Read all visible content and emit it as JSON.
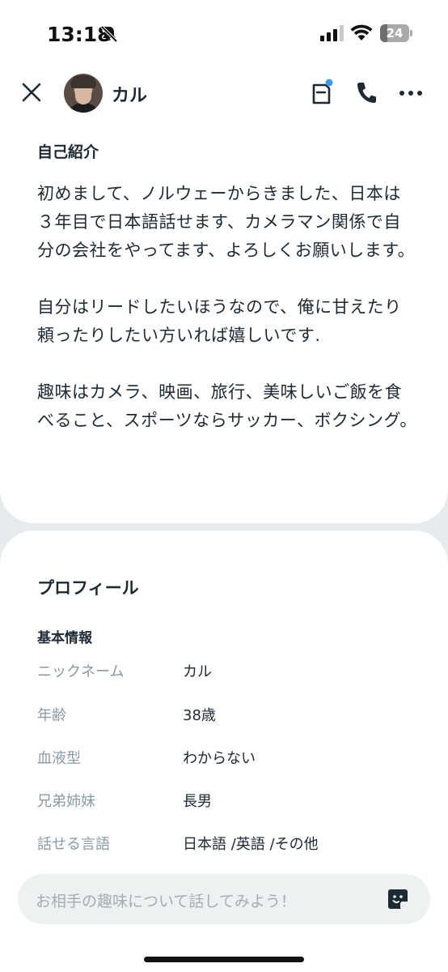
{
  "status_bar": {
    "time": "13:18",
    "battery_level": "24"
  },
  "header": {
    "username": "カル"
  },
  "intro": {
    "title": "自己紹介",
    "paragraphs": [
      "初めまして、ノルウェーからきました、日本は３年目で日本語話せます、カメラマン関係で自分の会社をやってます、よろしくお願いします。",
      "自分はリードしたいほうなので、俺に甘えたり頼ったりしたい方いれば嬉しいです.",
      "趣味はカメラ、映画、旅行、美味しいご飯を食べること、スポーツならサッカー、ボクシング。"
    ]
  },
  "profile": {
    "title": "プロフィール",
    "basic_info_title": "基本情報",
    "rows": [
      {
        "label": "ニックネーム",
        "value": "カル"
      },
      {
        "label": "年齢",
        "value": "38歳"
      },
      {
        "label": "血液型",
        "value": "わからない"
      },
      {
        "label": "兄弟姉妹",
        "value": "長男"
      },
      {
        "label": "話せる言語",
        "value": "日本語 /英語 /その他"
      }
    ]
  },
  "composer": {
    "placeholder": "お相手の趣味について話してみよう！"
  },
  "colors": {
    "text": "#1e2a33",
    "label": "#8a9aa3",
    "notification_dot": "#3d9be9",
    "background": "#e6eced"
  },
  "icons": [
    "bell-off-icon",
    "signal-icon",
    "wifi-icon",
    "close-icon",
    "memo-icon",
    "phone-icon",
    "more-icon",
    "sticker-icon"
  ]
}
